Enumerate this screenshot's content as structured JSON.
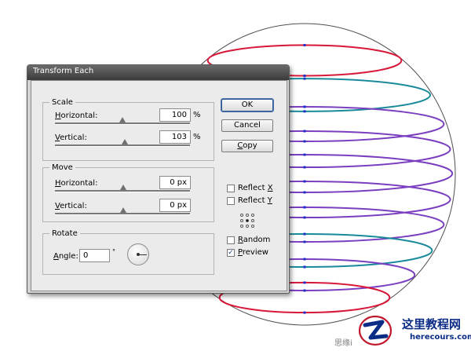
{
  "dialog": {
    "title": "Transform Each",
    "scale": {
      "legend": "Scale",
      "horizontal_label_key": "H",
      "horizontal_label_rest": "orizontal:",
      "horizontal_value": "100",
      "horizontal_unit": "%",
      "horizontal_percent": 100,
      "vertical_label_key": "V",
      "vertical_label_rest": "ertical:",
      "vertical_value": "103",
      "vertical_unit": "%",
      "vertical_percent": 103
    },
    "move": {
      "legend": "Move",
      "horizontal_label_key": "H",
      "horizontal_label_rest": "orizontal:",
      "horizontal_value": "0 px",
      "vertical_label_key": "V",
      "vertical_label_rest": "ertical:",
      "vertical_value": "0 px"
    },
    "rotate": {
      "legend": "Rotate",
      "angle_label_key": "A",
      "angle_label_rest": "ngle:",
      "angle_value": "0",
      "angle_unit": "°"
    },
    "buttons": {
      "ok": "OK",
      "cancel": "Cancel",
      "copy_key": "C",
      "copy_rest": "opy"
    },
    "options": {
      "reflect_x_prefix": "Reflect ",
      "reflect_x_key": "X",
      "reflect_x_checked": false,
      "reflect_y_prefix": "Reflect ",
      "reflect_y_key": "Y",
      "reflect_y_checked": false,
      "random_key": "R",
      "random_rest": "andom",
      "random_checked": false,
      "preview_key": "P",
      "preview_rest": "review",
      "preview_checked": true,
      "preview_mark": "✓"
    }
  },
  "watermark": {
    "site_name": "这里教程网",
    "site_url": "herecours.com",
    "small_text": "思缘i"
  },
  "colors": {
    "ellipse_top": "#d8183a",
    "ellipse_mid": "#7a3fc0",
    "ellipse_teal": "#1a8a9a",
    "sphere_outline": "#505050",
    "anchor_blue": "#1f2fc8"
  }
}
